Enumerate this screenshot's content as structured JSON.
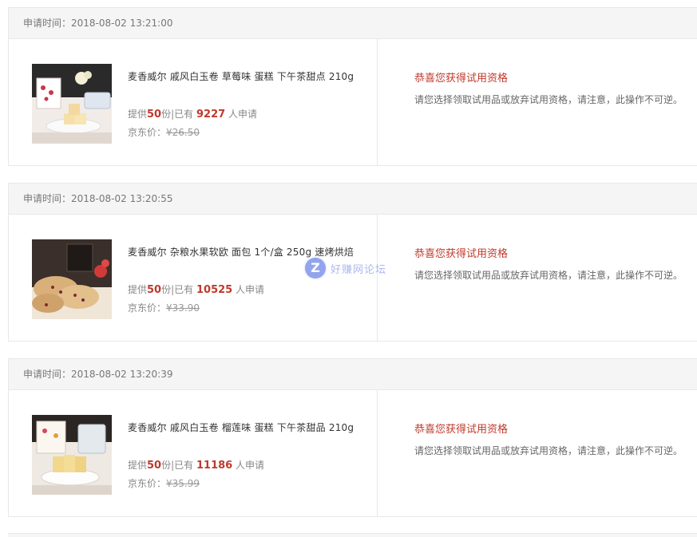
{
  "labels": {
    "apply_time_prefix": "申请时间：",
    "provide_prefix": "提供",
    "provide_mid": "份|已有",
    "provide_suffix": "人申请",
    "jd_price_prefix": "京东价："
  },
  "colors": {
    "accent_red": "#c0392b",
    "header_bg": "#f5f5f5",
    "border": "#e8e8e8"
  },
  "watermark": {
    "icon": "z-logo-icon",
    "letter": "Z",
    "text": "好赚网论坛"
  },
  "applications": [
    {
      "apply_time": "2018-08-02 13:21:00",
      "title": "麦香威尔 戚风白玉卷 草莓味 蛋糕 下午茶甜点 210g",
      "quantity": "50",
      "applicants": "9227",
      "price": "¥26.50",
      "result_title": "恭喜您获得试用资格",
      "result_note": "请您选择领取试用品或放弃试用资格，请注意，此操作不可逆。",
      "image_icon": "strawberry-cake-roll-image"
    },
    {
      "apply_time": "2018-08-02 13:20:55",
      "title": "麦香威尔 杂粮水果软欧 面包 1个/盒 250g 速烤烘焙",
      "quantity": "50",
      "applicants": "10525",
      "price": "¥33.90",
      "result_title": "恭喜您获得试用资格",
      "result_note": "请您选择领取试用品或放弃试用资格，请注意，此操作不可逆。",
      "image_icon": "fruit-bread-image"
    },
    {
      "apply_time": "2018-08-02 13:20:39",
      "title": "麦香威尔 戚风白玉卷 榴莲味 蛋糕 下午茶甜品 210g",
      "quantity": "50",
      "applicants": "11186",
      "price": "¥35.99",
      "result_title": "恭喜您获得试用资格",
      "result_note": "请您选择领取试用品或放弃试用资格，请注意，此操作不可逆。",
      "image_icon": "durian-cake-roll-image"
    }
  ]
}
